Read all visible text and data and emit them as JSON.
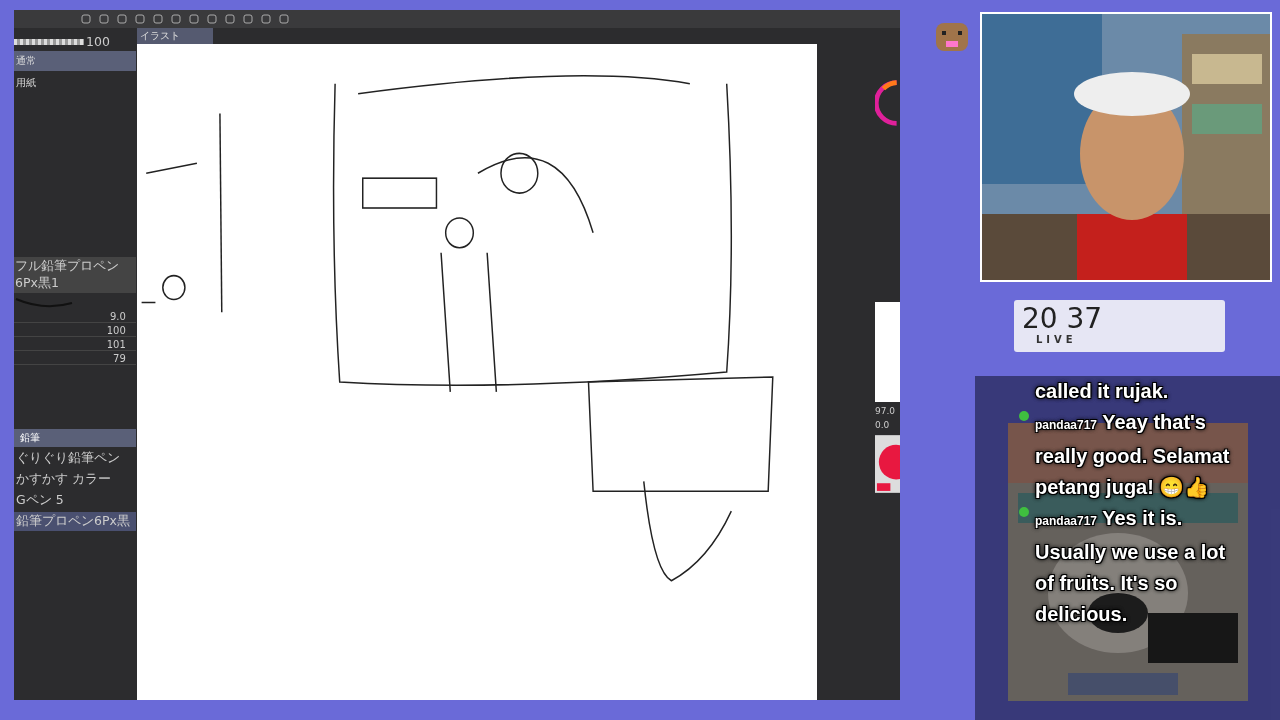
{
  "app": {
    "document_tab": "イラスト",
    "opacity": {
      "value": "100",
      "level": 1
    },
    "layers": [
      {
        "name": "通常",
        "selected": true
      },
      {
        "name": "用紙",
        "selected": false
      }
    ],
    "brush_name": "フル鉛筆プロペン6Px黒1",
    "brush_settings": [
      "9.0",
      "100",
      "101",
      "79"
    ],
    "subtool_group": "鉛筆",
    "subtools": [
      {
        "label": "ぐりぐり鉛筆ペン",
        "selected": false
      },
      {
        "label": "かすかす カラー",
        "selected": false
      },
      {
        "label": "Gペン 5",
        "selected": false
      },
      {
        "label": "鉛筆プロペン6Px黒",
        "selected": true
      }
    ],
    "navigator": [
      "97.0",
      "0.0"
    ]
  },
  "timer": {
    "time": "20 37",
    "status": "LIVE"
  },
  "chat": {
    "lines": [
      {
        "kind": "continuation",
        "text": "called it rujak."
      },
      {
        "kind": "message",
        "user": "pandaa717",
        "text": "Yeay that's really good. Selamat petang juga! 😁👍"
      },
      {
        "kind": "message",
        "user": "pandaa717",
        "text": "Yes it is. Usually we use a lot of fruits. It's so delicious."
      }
    ]
  }
}
